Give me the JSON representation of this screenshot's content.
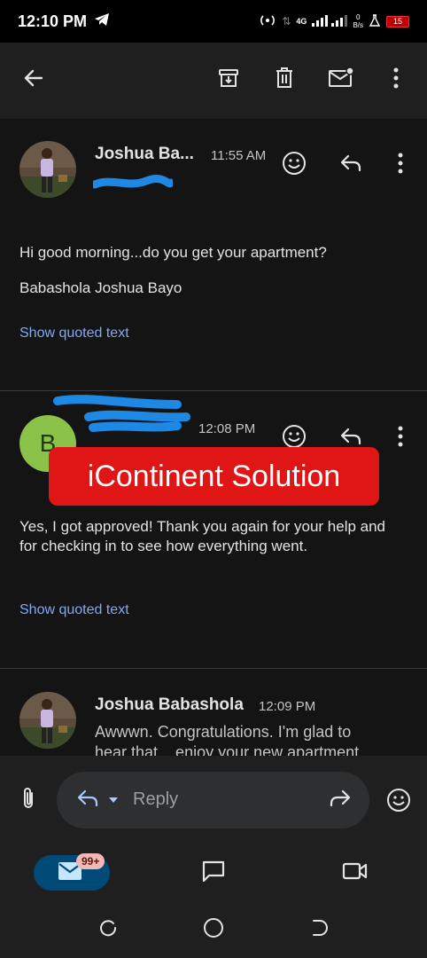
{
  "status_bar": {
    "time": "12:10 PM",
    "network": "4G",
    "speed_value": "0",
    "speed_unit": "B/s",
    "battery": "15"
  },
  "toolbar": {
    "back_icon": "arrow-back-icon",
    "archive_icon": "archive-icon",
    "delete_icon": "trash-icon",
    "mark_unread_icon": "mail-unread-icon",
    "more_icon": "more-vert-icon"
  },
  "messages": [
    {
      "sender": "Joshua Ba...",
      "time": "11:55 AM",
      "body_line1": "Hi good morning...do you get your apartment?",
      "body_line2": "Babashola Joshua Bayo",
      "quoted": "Show quoted text"
    },
    {
      "avatar_letter": "B",
      "time": "12:08 PM",
      "body_line1": "Yes, I got approved! Thank you again for your help and",
      "body_line2": "for checking in to see how everything went.",
      "quoted": "Show quoted text"
    },
    {
      "sender": "Joshua Babashola",
      "time": "12:09 PM",
      "body_line1": "Awwwn. Congratulations. I'm glad to",
      "body_line2": "hear that .. enjoy your new apartment."
    }
  ],
  "watermark": "iContinent Solution",
  "reply_bar": {
    "placeholder": "Reply"
  },
  "bottom_nav": {
    "mail_badge": "99+"
  },
  "colors": {
    "accent_link": "#7fa8f5",
    "mail_pill": "#004a77",
    "banner": "#e01515",
    "scribble": "#1e88e5"
  }
}
